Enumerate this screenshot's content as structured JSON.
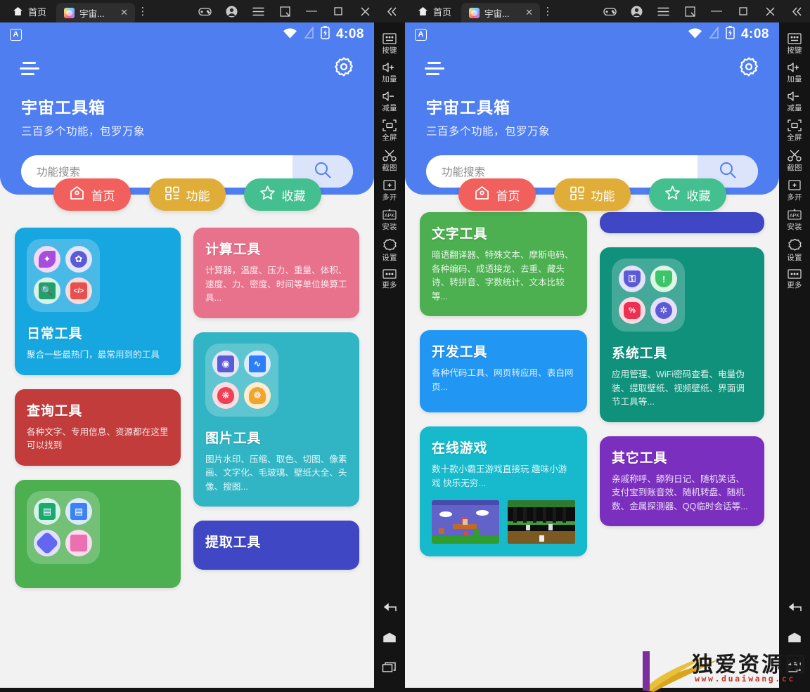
{
  "window": {
    "home_tab_label": "首页",
    "tab_label": "宇宙...",
    "tab_close": "✕",
    "kebab": "⋮",
    "controls": {
      "gamepad": "gamepad-icon",
      "account": "account-icon",
      "menu": "menu-icon",
      "resize": "resize-icon",
      "minimize": "—",
      "maximize": "▢",
      "close": "✕",
      "collapse": "«"
    }
  },
  "android": {
    "status": {
      "app_badge": "A",
      "wifi": "wifi-icon",
      "signal": "signal-icon",
      "battery": "battery-icon",
      "time": "4:08"
    },
    "appbar": {
      "menu": "hamburger-icon",
      "settings": "gear-icon"
    },
    "title": "宇宙工具箱",
    "subtitle": "三百多个功能，包罗万象",
    "search": {
      "placeholder": "功能搜索",
      "button_icon": "search-icon"
    },
    "chips": [
      {
        "label": "首页",
        "icon": "home-icon",
        "color": "#f2605d"
      },
      {
        "label": "功能",
        "icon": "grid-icon",
        "color": "#e0ae38"
      },
      {
        "label": "收藏",
        "icon": "star-icon",
        "color": "#44bf8f"
      }
    ]
  },
  "cards_left": {
    "col1": [
      {
        "title": "日常工具",
        "desc": "聚合一些最热门，最常用到的工具",
        "color": "#17a7e0",
        "icons": [
          {
            "name": "star-burst-icon",
            "bg": "#a64ddb",
            "ring": "#f3d9f7"
          },
          {
            "name": "clover-icon",
            "bg": "#5b5bd6",
            "ring": "#e5e5fb"
          },
          {
            "name": "doc-search-icon",
            "bg": "#22a06b",
            "ring": "#d9f2e7"
          },
          {
            "name": "code-monitor-icon",
            "bg": "#e8504f",
            "ring": "#fbdada"
          }
        ]
      },
      {
        "title": "查询工具",
        "desc": "各种文字、专用信息、资源都在这里可以找到",
        "color": "#c23c3c",
        "icons": []
      },
      {
        "title": "",
        "desc": "",
        "color": "#4caf50",
        "icons": [
          {
            "name": "id-card-icon",
            "bg": "#19a974",
            "ring": "#d7f3e8"
          },
          {
            "name": "document-icon",
            "bg": "#3b82f6",
            "ring": "#dbe9ff"
          },
          {
            "name": "diamond-icon",
            "bg": "#6366f1",
            "ring": "#e0e0ff"
          },
          {
            "name": "note-icon",
            "bg": "#ec6fb0",
            "ring": "#fcdcee"
          }
        ]
      }
    ],
    "col2": [
      {
        "title": "计算工具",
        "desc": "计算器，温度、压力、重量、体积、速度、力、密度、时间等单位换算工具...",
        "color": "#e8718c",
        "icons": []
      },
      {
        "title": "图片工具",
        "desc": "图片水印、压缩、取色、切图、像素画、文字化、毛玻璃、壁纸大全、头像、搜图...",
        "color": "#31b5c4",
        "icons": [
          {
            "name": "camera-icon",
            "bg": "#5b5bd6",
            "ring": "#e4e4fb"
          },
          {
            "name": "chart-image-icon",
            "bg": "#2d7ff9",
            "ring": "#dcebff"
          },
          {
            "name": "palette-icon",
            "bg": "#ef4056",
            "ring": "#fbdde1"
          },
          {
            "name": "tulip-icon",
            "bg": "#f0a52e",
            "ring": "#fdeccd"
          }
        ]
      },
      {
        "title": "提取工具",
        "desc": "",
        "color": "#3f47c4",
        "icons": []
      }
    ]
  },
  "cards_right": {
    "col1": [
      {
        "title": "文字工具",
        "desc": "暗语翻译器、特殊文本、摩斯电码、各种编码、成语接龙、去重、藏头诗、转拼音、字数统计、文本比较等...",
        "color": "#4caf50",
        "icons": []
      },
      {
        "title": "开发工具",
        "desc": "各种代码工具、网页转应用、表白网页...",
        "color": "#2196f3",
        "icons": []
      },
      {
        "title": "在线游戏",
        "desc": "数十款小霸王游戏直接玩 趣味小游戏 快乐无穷...",
        "color": "#16bacc",
        "icons": [],
        "thumbnails": [
          "game-thumb-mario",
          "game-thumb-contra"
        ]
      }
    ],
    "col2": [
      {
        "title": "",
        "desc": "",
        "color": "#3f47c4",
        "icons": []
      },
      {
        "title": "系统工具",
        "desc": "应用管理、WiFi密码查看、电量伪装、提取壁纸、视频壁纸、界面调节工具等...",
        "color": "#10917c",
        "icons": [
          {
            "name": "shield-lock-icon",
            "bg": "#5b5bd6",
            "ring": "#e3e3fb"
          },
          {
            "name": "shield-alert-icon",
            "bg": "#3ec46a",
            "ring": "#dcf7e3"
          },
          {
            "name": "discount-icon",
            "bg": "#ef2f4f",
            "ring": "#fcdbe1"
          },
          {
            "name": "gear-flower-icon",
            "bg": "#5b5bd6",
            "ring": "#e9def8"
          }
        ]
      },
      {
        "title": "其它工具",
        "desc": "亲戚称呼、舔狗日记、随机笑话、支付宝到账音效、随机转盘、随机数、金属探测器、QQ临时会话等...",
        "color": "#7b2fbe",
        "icons": []
      }
    ]
  },
  "etools": [
    {
      "icon": "keyboard-icon",
      "label": "按键"
    },
    {
      "icon": "volume-up-icon",
      "label": "加量"
    },
    {
      "icon": "volume-down-icon",
      "label": "减量"
    },
    {
      "icon": "fullscreen-icon",
      "label": "全屏"
    },
    {
      "icon": "scissors-icon",
      "label": "截图"
    },
    {
      "icon": "multi-window-icon",
      "label": "多开"
    },
    {
      "icon": "apk-install-icon",
      "label": "安装"
    },
    {
      "icon": "settings-icon",
      "label": "设置"
    },
    {
      "icon": "more-icon",
      "label": "更多"
    }
  ],
  "navtools": [
    {
      "icon": "back-icon",
      "label": "back"
    },
    {
      "icon": "home-icon",
      "label": "home"
    },
    {
      "icon": "recents-icon",
      "label": "recents"
    }
  ],
  "watermark": {
    "text": "独爱资源网",
    "url": "www.duaiwang.cc"
  }
}
